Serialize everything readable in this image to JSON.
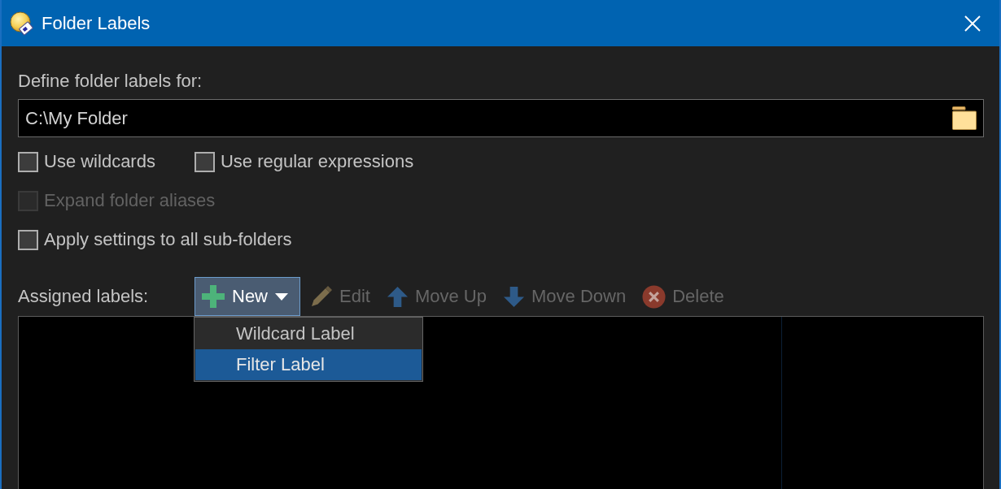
{
  "window": {
    "title": "Folder Labels"
  },
  "folder": {
    "label": "Define folder labels for:",
    "path": "C:\\My Folder"
  },
  "option_rows": [
    {
      "options": [
        {
          "label": "Use wildcards",
          "checked": false,
          "disabled": false
        },
        {
          "label": "Use regular expressions",
          "checked": false,
          "disabled": false
        }
      ]
    },
    {
      "options": [
        {
          "label": "Expand folder aliases",
          "checked": false,
          "disabled": true
        }
      ]
    },
    {
      "options": [
        {
          "label": "Apply settings to all sub-folders",
          "checked": false,
          "disabled": false
        }
      ]
    }
  ],
  "assigned": {
    "label": "Assigned labels:",
    "toolbar": [
      {
        "kind": "dropdown",
        "label": "New",
        "disabled": false,
        "expanded": true,
        "menu": [
          {
            "label": "Wildcard Label",
            "selected": false
          },
          {
            "label": "Filter Label",
            "selected": true
          }
        ]
      },
      {
        "kind": "button",
        "label": "Edit",
        "disabled": true
      },
      {
        "kind": "button",
        "label": "Move Up",
        "disabled": true
      },
      {
        "kind": "button",
        "label": "Move Down",
        "disabled": true
      },
      {
        "kind": "button",
        "label": "Delete",
        "disabled": true
      }
    ]
  }
}
